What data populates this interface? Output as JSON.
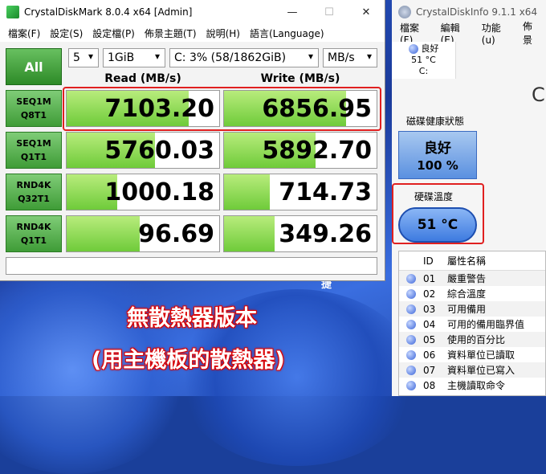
{
  "cdm": {
    "title": "CrystalDiskMark 8.0.4 x64 [Admin]",
    "window_buttons": [
      "—",
      "☐",
      "✕"
    ],
    "menu": [
      "檔案(F)",
      "設定(S)",
      "設定檔(P)",
      "佈景主題(T)",
      "說明(H)",
      "語言(Language)"
    ],
    "all_label": "All",
    "count_value": "5",
    "size_value": "1GiB",
    "drive_value": "C: 3% (58/1862GiB)",
    "unit_value": "MB/s",
    "read_header": "Read (MB/s)",
    "write_header": "Write (MB/s)",
    "rows": [
      {
        "l1": "SEQ1M",
        "l2": "Q8T1",
        "read": "7103.20",
        "write": "6856.95",
        "read_fill": 0.8,
        "write_fill": 0.8
      },
      {
        "l1": "SEQ1M",
        "l2": "Q1T1",
        "read": "5760.03",
        "write": "5892.70",
        "read_fill": 0.58,
        "write_fill": 0.6
      },
      {
        "l1": "RND4K",
        "l2": "Q32T1",
        "read": "1000.18",
        "write": "714.73",
        "read_fill": 0.33,
        "write_fill": 0.3
      },
      {
        "l1": "RND4K",
        "l2": "Q1T1",
        "read": "96.69",
        "write": "349.26",
        "read_fill": 0.48,
        "write_fill": 0.33
      }
    ],
    "comment": ""
  },
  "overlay": {
    "line1": "無散熱器版本",
    "line2": "(用主機板的散熱器)",
    "partial": "捷"
  },
  "cdi": {
    "title": "CrystalDiskInfo 9.1.1 x64",
    "menu": [
      "檔案(F)",
      "編輯(E)",
      "功能(u)",
      "佈景"
    ],
    "drive_status": "良好",
    "drive_temp": "51 °C",
    "drive_letter": "C:",
    "partial_c": "C",
    "health_label": "磁碟健康狀態",
    "health_status": "良好",
    "health_percent": "100 %",
    "temp_label": "硬碟溫度",
    "temp_value": "51 °C",
    "list_header": {
      "id": "ID",
      "name": "屬性名稱"
    },
    "attributes": [
      {
        "id": "01",
        "name": "嚴重警告"
      },
      {
        "id": "02",
        "name": "綜合溫度"
      },
      {
        "id": "03",
        "name": "可用備用"
      },
      {
        "id": "04",
        "name": "可用的備用臨界值"
      },
      {
        "id": "05",
        "name": "使用的百分比"
      },
      {
        "id": "06",
        "name": "資料單位已讀取"
      },
      {
        "id": "07",
        "name": "資料單位已寫入"
      },
      {
        "id": "08",
        "name": "主機讀取命令"
      }
    ]
  },
  "colors": {
    "cdm_green": "#3f9c37",
    "cdi_blue": "#3e7be0",
    "highlight_red": "#e02020"
  }
}
